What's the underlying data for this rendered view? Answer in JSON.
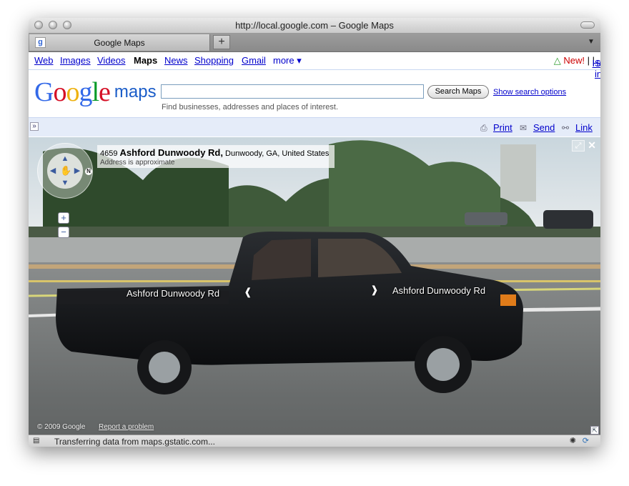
{
  "window": {
    "title": "http://local.google.com – Google Maps"
  },
  "tabs": [
    {
      "label": "Google Maps",
      "favicon": "google-favicon-icon"
    }
  ],
  "newtab": {
    "label": "+"
  },
  "nav": {
    "web": "Web",
    "images": "Images",
    "videos": "Videos",
    "maps": "Maps",
    "news": "News",
    "shopping": "Shopping",
    "gmail": "Gmail",
    "more": "more ▾"
  },
  "user": {
    "new": "New!",
    "help": "Help",
    "signin": "Sign in",
    "sep": "|",
    "new_icon": "beaker-icon"
  },
  "logo": {
    "g1": "G",
    "o1": "o",
    "o2": "o",
    "g2": "g",
    "l": "l",
    "e": "e",
    "maps": "maps"
  },
  "search": {
    "value": "",
    "button": "Search Maps",
    "options": "Show search options",
    "hint": "Find businesses, addresses and places of interest."
  },
  "tools": {
    "print": "Print",
    "send": "Send",
    "link": "Link"
  },
  "streetview": {
    "addr_number": "4659",
    "addr_street": "Ashford Dunwoody Rd,",
    "addr_city": "Dunwoody, GA, United States",
    "addr_note": "Address is approximate",
    "road_left": "Ashford Dunwoody Rd",
    "road_right": "Ashford Dunwoody Rd",
    "copyright": "© 2009 Google",
    "report": "Report a problem",
    "compass": "N"
  },
  "status": {
    "text": "Transferring data from maps.gstatic.com..."
  },
  "colors": {
    "link": "#0000cc",
    "new": "#cc0000",
    "toolstrip": "#e5ecf9",
    "google_blue": "#3369e8",
    "google_red": "#d50f25",
    "google_yellow": "#eeb211",
    "google_green": "#009925"
  }
}
